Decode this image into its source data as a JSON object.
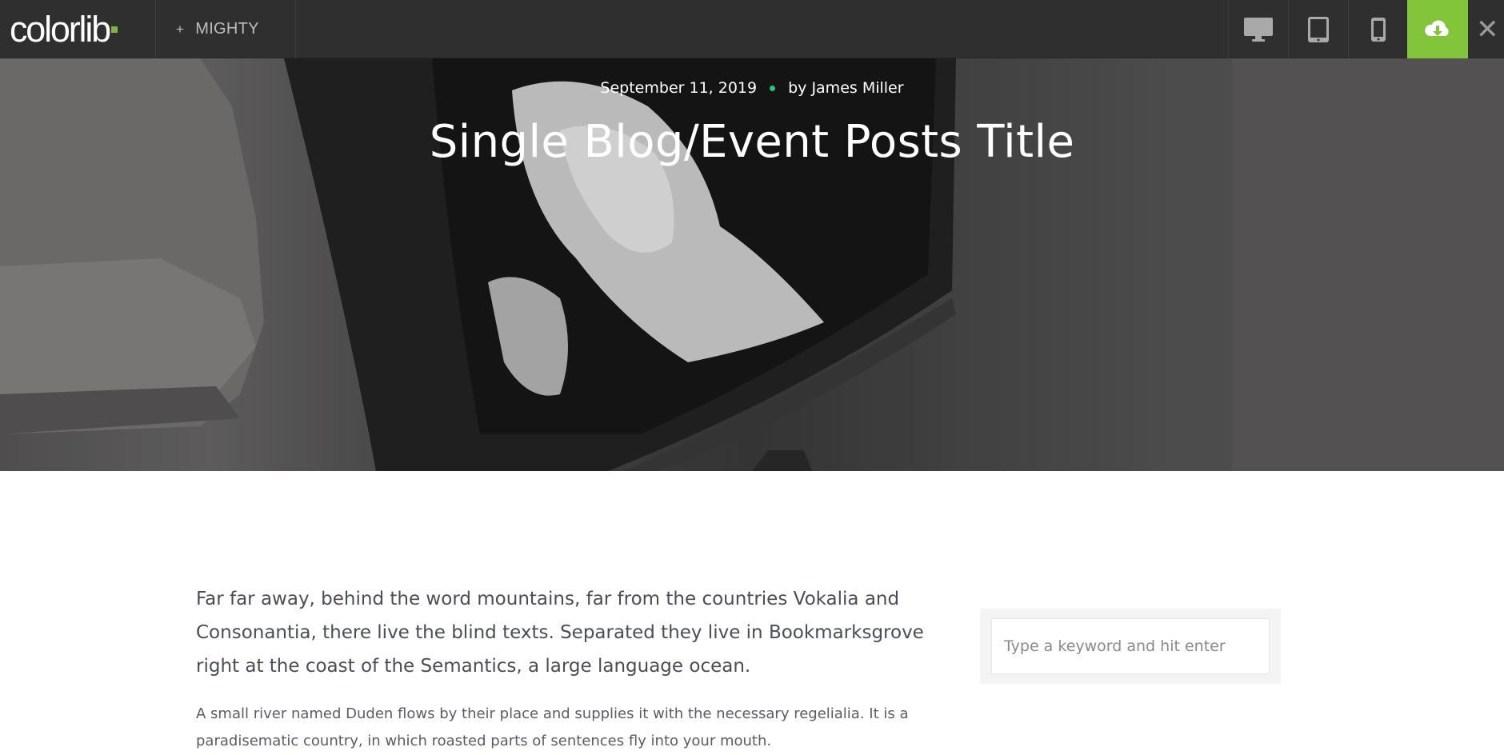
{
  "topbar": {
    "logo_text": "colorlib",
    "theme_button": {
      "icon": "plus-icon",
      "label": "MIGHTY"
    },
    "devices": [
      {
        "name": "desktop-icon"
      },
      {
        "name": "tablet-icon"
      },
      {
        "name": "mobile-icon"
      }
    ],
    "download_icon": "cloud-download-icon",
    "close_icon": "close-icon",
    "accent_color": "#82c43a"
  },
  "hero": {
    "date": "September 11, 2019",
    "author": "by James Miller",
    "title": "Single Blog/Event Posts Title",
    "separator_color": "#23c77f"
  },
  "content": {
    "lead": "Far far away, behind the word mountains, far from the countries Vokalia and Consonantia, there live the blind texts. Separated they live in Bookmarksgrove right at the coast of the Semantics, a large language ocean.",
    "paragraph": "A small river named Duden flows by their place and supplies it with the necessary regelialia. It is a paradisematic country, in which roasted parts of sentences fly into your mouth."
  },
  "sidebar": {
    "search": {
      "placeholder": "Type a keyword and hit enter",
      "value": ""
    }
  }
}
